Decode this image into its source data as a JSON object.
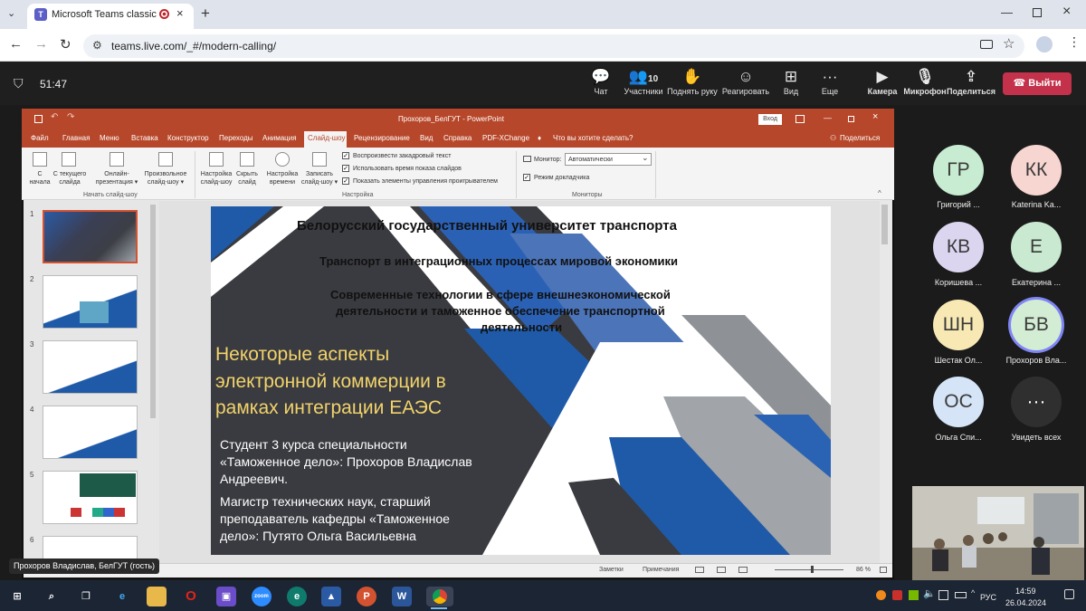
{
  "browser": {
    "tab_title": "Microsoft Teams classic",
    "url": "teams.live.com/_#/modern-calling/"
  },
  "meeting": {
    "timer": "51:47",
    "participants_count": "10",
    "controls": {
      "chat": "Чат",
      "participants": "Участники",
      "raise_hand": "Поднять руку",
      "react": "Реагировать",
      "view": "Вид",
      "more": "Еще",
      "camera": "Камера",
      "mic": "Микрофон",
      "share": "Поделиться",
      "leave": "Выйти"
    },
    "speaker_label": "Прохоров Владислав, БелГУТ (гость)"
  },
  "ppt": {
    "title": "Прохоров_БелГУТ - PowerPoint",
    "enter_btn": "Вход",
    "share_btn": "Поделиться",
    "tell_me": "Что вы хотите сделать?",
    "menu": [
      "Файл",
      "Главная",
      "Меню",
      "Вставка",
      "Конструктор",
      "Переходы",
      "Анимация",
      "Слайд-шоу",
      "Рецензирование",
      "Вид",
      "Справка",
      "PDF-XChange"
    ],
    "ribbon": {
      "from_start": [
        "С",
        "начала"
      ],
      "from_current": [
        "С текущего",
        "слайда"
      ],
      "online": [
        "Онлайн-",
        "презентация ▾"
      ],
      "custom": [
        "Произвольное",
        "слайд-шоу ▾"
      ],
      "setup": [
        "Настройка",
        "слайд-шоу"
      ],
      "hide": [
        "Скрыть",
        "слайд"
      ],
      "timings": [
        "Настройка",
        "времени"
      ],
      "record": [
        "Записать",
        "слайд-шоу ▾"
      ],
      "opt1": "Воспроизвести закадровый текст",
      "opt2": "Использовать время показа слайдов",
      "opt3": "Показать элементы управления проигрывателем",
      "monitor_label": "Монитор:",
      "monitor_value": "Автоматически",
      "presenter_view": "Режим докладчика",
      "group_start": "Начать слайд-шоу",
      "group_setup": "Настройка",
      "group_monitors": "Мониторы"
    },
    "thumb_numbers": [
      "1",
      "2",
      "3",
      "4",
      "5",
      "6"
    ],
    "status": {
      "notes": "Заметки",
      "comments": "Примечания",
      "zoom": "86 %"
    }
  },
  "slide": {
    "university": "Белорусский государственный университет транспорта",
    "line2": "Транспорт в интеграционных процессах мировой экономики",
    "line3a": "Современные технологии в сфере внешнеэкономической",
    "line3b": "деятельности и таможенное обеспечение транспортной",
    "line3c": "деятельности",
    "title1": "Некоторые аспекты",
    "title2": "электронной коммерции в",
    "title3": "рамках интеграции ЕАЭС",
    "student1": "Студент 3 курса специальности",
    "student2": "«Таможенное дело»: Прохоров Владислав",
    "student3": "Андреевич.",
    "master1": "Магистр технических наук, старший",
    "master2": "преподаватель кафедры «Таможенное",
    "master3": "дело»: Путято Ольга Васильевна"
  },
  "participants": [
    {
      "initials": "ГР",
      "name": "Григорий ...",
      "color": "#c7ecd2"
    },
    {
      "initials": "КК",
      "name": "Katerina Ka...",
      "color": "#f7d5d0"
    },
    {
      "initials": "КВ",
      "name": "Коришева ...",
      "color": "#dcd5f0"
    },
    {
      "initials": "Е",
      "name": "Екатерина ...",
      "color": "#c9ead1"
    },
    {
      "initials": "ШН",
      "name": "Шестак Ол...",
      "color": "#f8e9b4"
    },
    {
      "initials": "БВ",
      "name": "Прохоров Вла...",
      "color": "#d3ecd4"
    },
    {
      "initials": "ОС",
      "name": "Ольга Спи...",
      "color": "#d5e4f7"
    },
    {
      "initials": "···",
      "name": "Увидеть всех",
      "color": "#2f2f2f"
    }
  ],
  "taskbar": {
    "lang": "РУС",
    "time": "14:59",
    "date": "26.04.2024"
  }
}
